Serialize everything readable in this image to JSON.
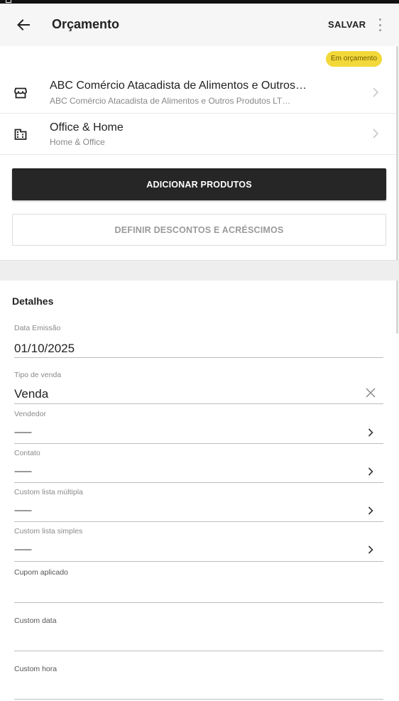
{
  "appbar": {
    "title": "Orçamento",
    "save_label": "SALVAR"
  },
  "status_badge": {
    "label": "Em orçamento",
    "color": "#f3d83a"
  },
  "customer": {
    "name": "ABC Comércio Atacadista de Alimentos e Outros…",
    "full_name": "ABC Comércio Atacadista de Alimentos e Outros Produtos LT…",
    "icon": "store-icon"
  },
  "company": {
    "name": "Office & Home",
    "subtitle": "Home & Office",
    "icon": "building-icon"
  },
  "actions": {
    "add_products": "ADICIONAR PRODUTOS",
    "discounts": "DEFINIR DESCONTOS E ACRÉSCIMOS"
  },
  "details": {
    "title": "Detalhes",
    "fields": [
      {
        "label": "Data Emissão",
        "value": "01/10/2025"
      },
      {
        "label": "Tipo de venda",
        "value": "Venda",
        "trailing": "close-icon"
      },
      {
        "label": "Vendedor",
        "value": "--------",
        "trailing": "chevron-right-icon"
      },
      {
        "label": "Contato",
        "value": "--------",
        "trailing": "chevron-right-icon"
      },
      {
        "label": "Custom lista múltipla",
        "value": "--------",
        "trailing": "chevron-right-icon"
      },
      {
        "label": "Custom lista simples",
        "value": "--------",
        "trailing": "chevron-right-icon"
      },
      {
        "label": "Cupom aplicado",
        "value": ""
      },
      {
        "label": "Custom data",
        "value": ""
      },
      {
        "label": "Custom hora",
        "value": ""
      }
    ]
  }
}
